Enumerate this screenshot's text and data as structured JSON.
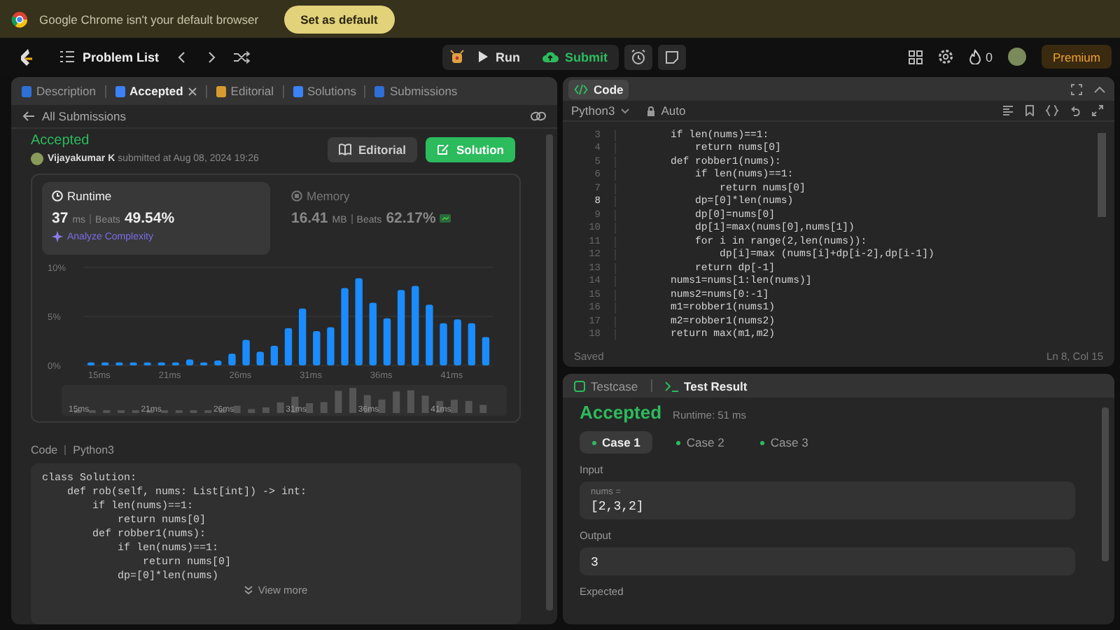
{
  "browser_banner": {
    "message": "Google Chrome isn't your default browser",
    "button": "Set as default"
  },
  "nav": {
    "problem_list": "Problem List",
    "run": "Run",
    "submit": "Submit",
    "streak": "0",
    "premium": "Premium"
  },
  "left_panel": {
    "tabs": [
      {
        "label": "Description",
        "selected": false,
        "closable": false,
        "color": "#2f6fd6"
      },
      {
        "label": "Accepted",
        "selected": true,
        "closable": true,
        "color": "#3b82f6"
      },
      {
        "label": "Editorial",
        "selected": false,
        "closable": false,
        "color": "#d69a2f"
      },
      {
        "label": "Solutions",
        "selected": false,
        "closable": false,
        "color": "#3b82f6"
      },
      {
        "label": "Submissions",
        "selected": false,
        "closable": false,
        "color": "#2f6fd6"
      }
    ],
    "back_link": "All Submissions",
    "submission": {
      "status": "Accepted",
      "byline": "**Vijayakumar K** submitted at Aug 08, 2024 19:26",
      "buttons": [
        {
          "label": "Editorial",
          "kind": "secondary"
        },
        {
          "label": "Solution",
          "kind": "primary"
        }
      ]
    },
    "stats": [
      {
        "title": "Runtime",
        "value": "37",
        "unit": "ms",
        "beats_label": "Beats",
        "beats": "49.54%",
        "link": "Analyze Complexity",
        "selected": true
      },
      {
        "title": "Memory",
        "value": "16.41",
        "unit": "MB",
        "beats_label": "Beats",
        "beats": "62.17%",
        "selected": false
      }
    ],
    "chart_data": {
      "type": "bar",
      "categories": [
        "15ms",
        null,
        null,
        null,
        null,
        "21ms",
        null,
        null,
        null,
        null,
        "26ms",
        null,
        null,
        null,
        null,
        "31ms",
        null,
        null,
        null,
        null,
        "36ms",
        null,
        null,
        null,
        null,
        "41ms",
        null,
        null,
        null
      ],
      "series": [
        {
          "color": "#1a8cff",
          "values": [
            0.3,
            0.3,
            0.3,
            0.3,
            0.3,
            0.3,
            0.3,
            0.6,
            0.3,
            0.5,
            1.2,
            2.6,
            1.4,
            2.0,
            3.8,
            5.8,
            3.5,
            3.9,
            7.9,
            8.9,
            6.4,
            4.8,
            7.7,
            8.1,
            6.2,
            4.3,
            4.7,
            4.3,
            2.9
          ]
        }
      ],
      "ylim": [
        0,
        10
      ],
      "yticks": [
        {
          "value": 0,
          "label": "0%"
        },
        {
          "value": 5,
          "label": "5%"
        },
        {
          "value": 10,
          "label": "10%"
        }
      ]
    },
    "overview": {
      "labels": [
        "15ms",
        "21ms",
        "26ms",
        "31ms",
        "36ms",
        "41ms"
      ]
    },
    "code": {
      "label": "Code",
      "language": "Python3",
      "more": "View more",
      "lines": [
        "class Solution:",
        "    def rob(self, nums: List[int]) -> int:",
        "        if len(nums)==1:",
        "            return nums[0]",
        "        def robber1(nums):",
        "            if len(nums)==1:",
        "                return nums[0]",
        "            dp=[0]*len(nums)"
      ]
    }
  },
  "editor": {
    "tab": "Code",
    "language": "Python3",
    "mode": "Auto",
    "status": "Saved",
    "cursor": "Ln 8, Col 15",
    "lines": [
      {
        "number": "3",
        "code": "        if len(nums)==1:",
        "current": false
      },
      {
        "number": "4",
        "code": "            return nums[0]",
        "current": false
      },
      {
        "number": "5",
        "code": "        def robber1(nums):",
        "current": false
      },
      {
        "number": "6",
        "code": "            if len(nums)==1:",
        "current": false
      },
      {
        "number": "7",
        "code": "                return nums[0]",
        "current": false
      },
      {
        "number": "8",
        "code": "            dp=[0]*len(nums)",
        "current": true
      },
      {
        "number": "9",
        "code": "            dp[0]=nums[0]",
        "current": false
      },
      {
        "number": "10",
        "code": "            dp[1]=max(nums[0],nums[1])",
        "current": false
      },
      {
        "number": "11",
        "code": "            for i in range(2,len(nums)):",
        "current": false
      },
      {
        "number": "12",
        "code": "                dp[i]=max (nums[i]+dp[i-2],dp[i-1])",
        "current": false
      },
      {
        "number": "13",
        "code": "            return dp[-1]",
        "current": false
      },
      {
        "number": "14",
        "code": "        nums1=nums[1:len(nums)]",
        "current": false
      },
      {
        "number": "15",
        "code": "        nums2=nums[0:-1]",
        "current": false
      },
      {
        "number": "16",
        "code": "        m1=robber1(nums1)",
        "current": false
      },
      {
        "number": "17",
        "code": "        m2=robber1(nums2)",
        "current": false
      },
      {
        "number": "18",
        "code": "        return max(m1,m2)",
        "current": false
      }
    ]
  },
  "test_result": {
    "tabs": [
      {
        "label": "Testcase",
        "selected": false
      },
      {
        "label": "Test Result",
        "selected": true
      }
    ],
    "status": "Accepted",
    "runtime": "Runtime: 51 ms",
    "cases": [
      {
        "label": "Case 1",
        "selected": true
      },
      {
        "label": "Case 2",
        "selected": false
      },
      {
        "label": "Case 3",
        "selected": false
      }
    ],
    "input_label": "Input",
    "param": "nums =",
    "input": "[2,3,2]",
    "output_label": "Output",
    "output": "3",
    "expected_label": "Expected"
  }
}
